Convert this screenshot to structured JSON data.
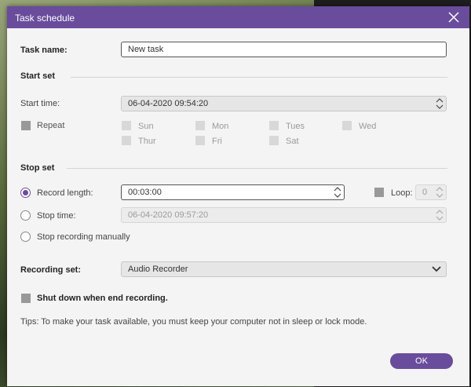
{
  "dialog": {
    "title": "Task schedule"
  },
  "task": {
    "label": "Task name:",
    "value": "New task"
  },
  "start": {
    "section": "Start set",
    "time_label": "Start time:",
    "time_value": "06-04-2020 09:54:20",
    "repeat_label": "Repeat",
    "days": [
      "Sun",
      "Mon",
      "Tues",
      "Wed",
      "Thur",
      "Fri",
      "Sat"
    ]
  },
  "stop": {
    "section": "Stop set",
    "record_length_label": "Record length:",
    "record_length_value": "00:03:00",
    "loop_label": "Loop:",
    "loop_value": "0",
    "stop_time_label": "Stop time:",
    "stop_time_value": "06-04-2020 09:57:20",
    "manual_label": "Stop recording manually"
  },
  "recording": {
    "label": "Recording set:",
    "value": "Audio Recorder"
  },
  "shutdown_label": "Shut down when end recording.",
  "tips": "Tips: To make your task available, you must keep your computer not in sleep or lock mode.",
  "ok_label": "OK",
  "colors": {
    "accent": "#6a4c9c"
  }
}
